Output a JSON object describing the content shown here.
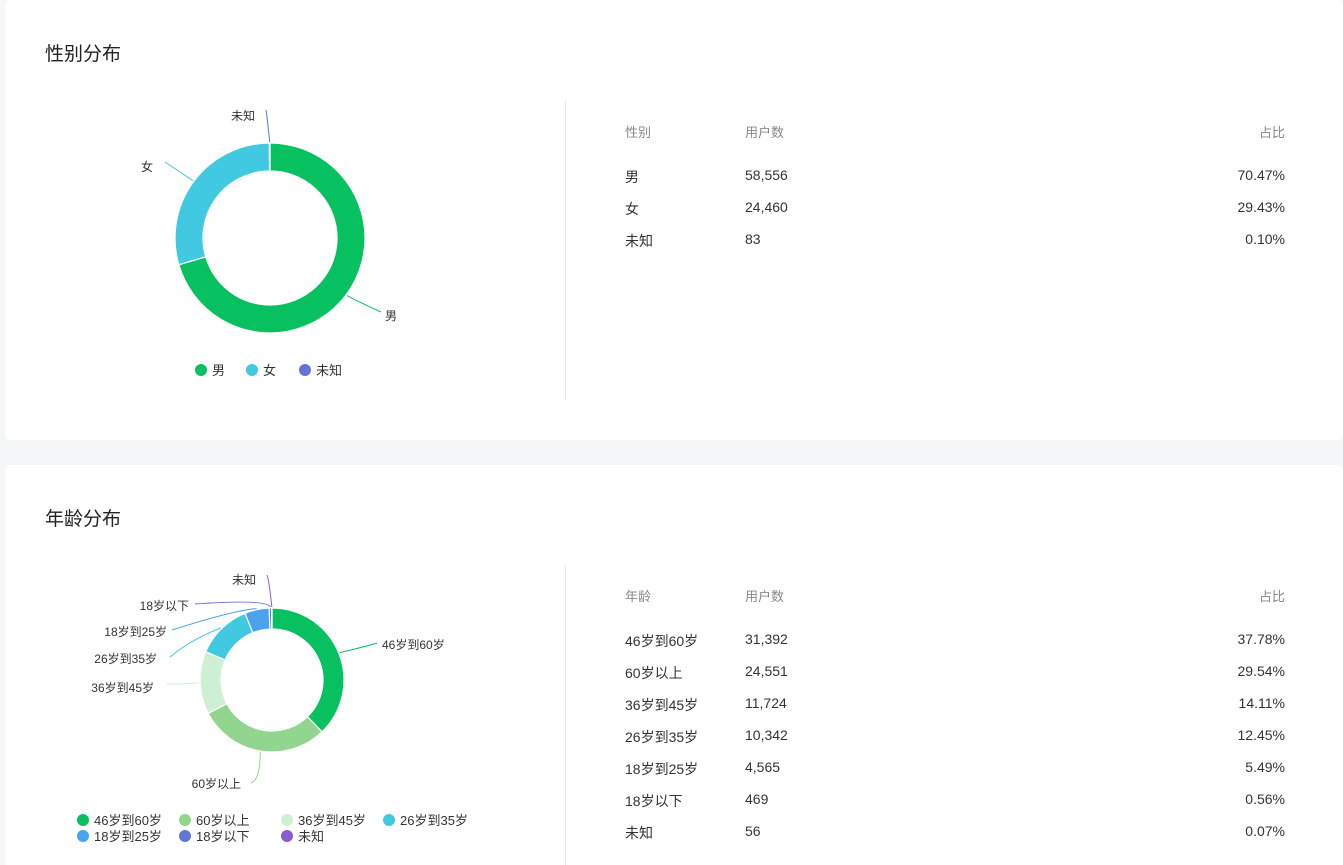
{
  "gender": {
    "title": "性别分布",
    "table": {
      "headers": [
        "性别",
        "用户数",
        "占比"
      ],
      "rows": [
        [
          "男",
          "58,556",
          "70.47%"
        ],
        [
          "女",
          "24,460",
          "29.43%"
        ],
        [
          "未知",
          "83",
          "0.10%"
        ]
      ]
    },
    "chart_data": {
      "type": "pie",
      "categories": [
        "男",
        "女",
        "未知"
      ],
      "values": [
        58556,
        24460,
        83
      ],
      "colors": [
        "#07c160",
        "#40c9e0",
        "#6376d5"
      ]
    }
  },
  "age": {
    "title": "年龄分布",
    "table": {
      "headers": [
        "年龄",
        "用户数",
        "占比"
      ],
      "rows": [
        [
          "46岁到60岁",
          "31,392",
          "37.78%"
        ],
        [
          "60岁以上",
          "24,551",
          "29.54%"
        ],
        [
          "36岁到45岁",
          "11,724",
          "14.11%"
        ],
        [
          "26岁到35岁",
          "10,342",
          "12.45%"
        ],
        [
          "18岁到25岁",
          "4,565",
          "5.49%"
        ],
        [
          "18岁以下",
          "469",
          "0.56%"
        ],
        [
          "未知",
          "56",
          "0.07%"
        ]
      ]
    },
    "chart_data": {
      "type": "pie",
      "categories": [
        "46岁到60岁",
        "60岁以上",
        "36岁到45岁",
        "26岁到35岁",
        "18岁到25岁",
        "18岁以下",
        "未知"
      ],
      "values": [
        31392,
        24551,
        11724,
        10342,
        4565,
        469,
        56
      ],
      "colors": [
        "#07c160",
        "#91d58e",
        "#cfefd4",
        "#40c9e0",
        "#4aa3ef",
        "#6376d5",
        "#8a5cd0"
      ]
    }
  }
}
